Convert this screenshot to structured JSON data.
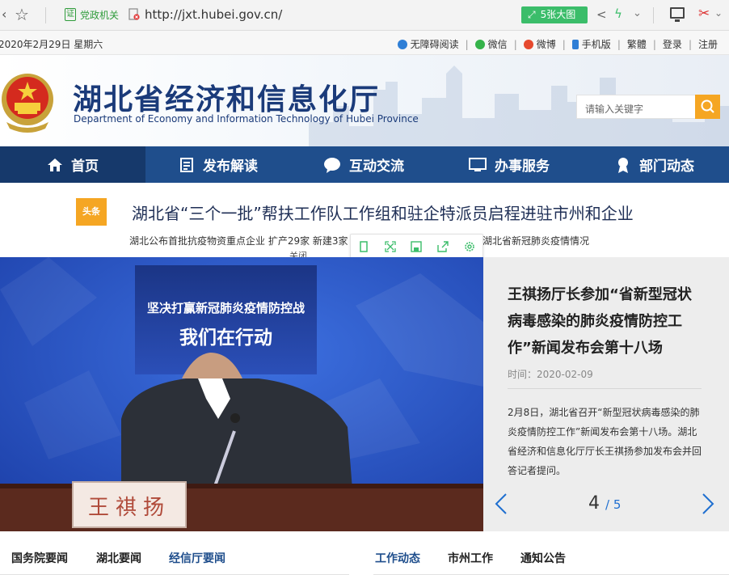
{
  "browser": {
    "gov_badge": "证",
    "gov_label": "党政机关",
    "url": "http://jxt.hubei.gov.cn/",
    "image_button": "5张大图"
  },
  "top_bar": {
    "date": "2020年2月29日  星期六",
    "links": [
      "无障碍阅读",
      "微信",
      "微博",
      "手机版",
      "繁體",
      "登录",
      "注册"
    ]
  },
  "header": {
    "title_cn": "湖北省经济和信息化厅",
    "title_en": "Department of Economy and Information Technology of Hubei Province",
    "search_placeholder": "请输入关键字"
  },
  "nav": {
    "items": [
      "首页",
      "发布解读",
      "互动交流",
      "办事服务",
      "部门动态"
    ]
  },
  "headline": {
    "badge": "头条",
    "title": "湖北省“三个一批”帮扶工作队工作组和驻企特派员启程进驻市州和企业",
    "sub_text": "湖北公布首批抗疫物资重点企业 扩产29家 新建3家 ·",
    "sub_tail": "湖北省新冠肺炎疫情情况",
    "close_label": "关闭"
  },
  "carousel": {
    "banner_line1": "坚决打赢新冠肺炎疫情防控战",
    "banner_line2": "我们在行动",
    "nameplate": "王祺扬",
    "news_title": "王祺扬厅长参加“省新型冠状病毒感染的肺炎疫情防控工作”新闻发布会第十八场",
    "time_label": "时间：",
    "time_value": "2020-02-09",
    "summary": "2月8日，湖北省召开“新型冠状病毒感染的肺炎疫情防控工作”新闻发布会第十八场。湖北省经济和信息化厅厅长王祺扬参加发布会并回答记者提问。",
    "current_page": "4",
    "total_pages": "/ 5"
  },
  "tabs_left": [
    "国务院要闻",
    "湖北要闻",
    "经信厅要闻"
  ],
  "tabs_right": [
    "工作动态",
    "市州工作",
    "通知公告"
  ],
  "colors": {
    "nav_bg": "#1f4e8c",
    "accent_orange": "#f5a623",
    "title_blue": "#1b3b7a"
  }
}
